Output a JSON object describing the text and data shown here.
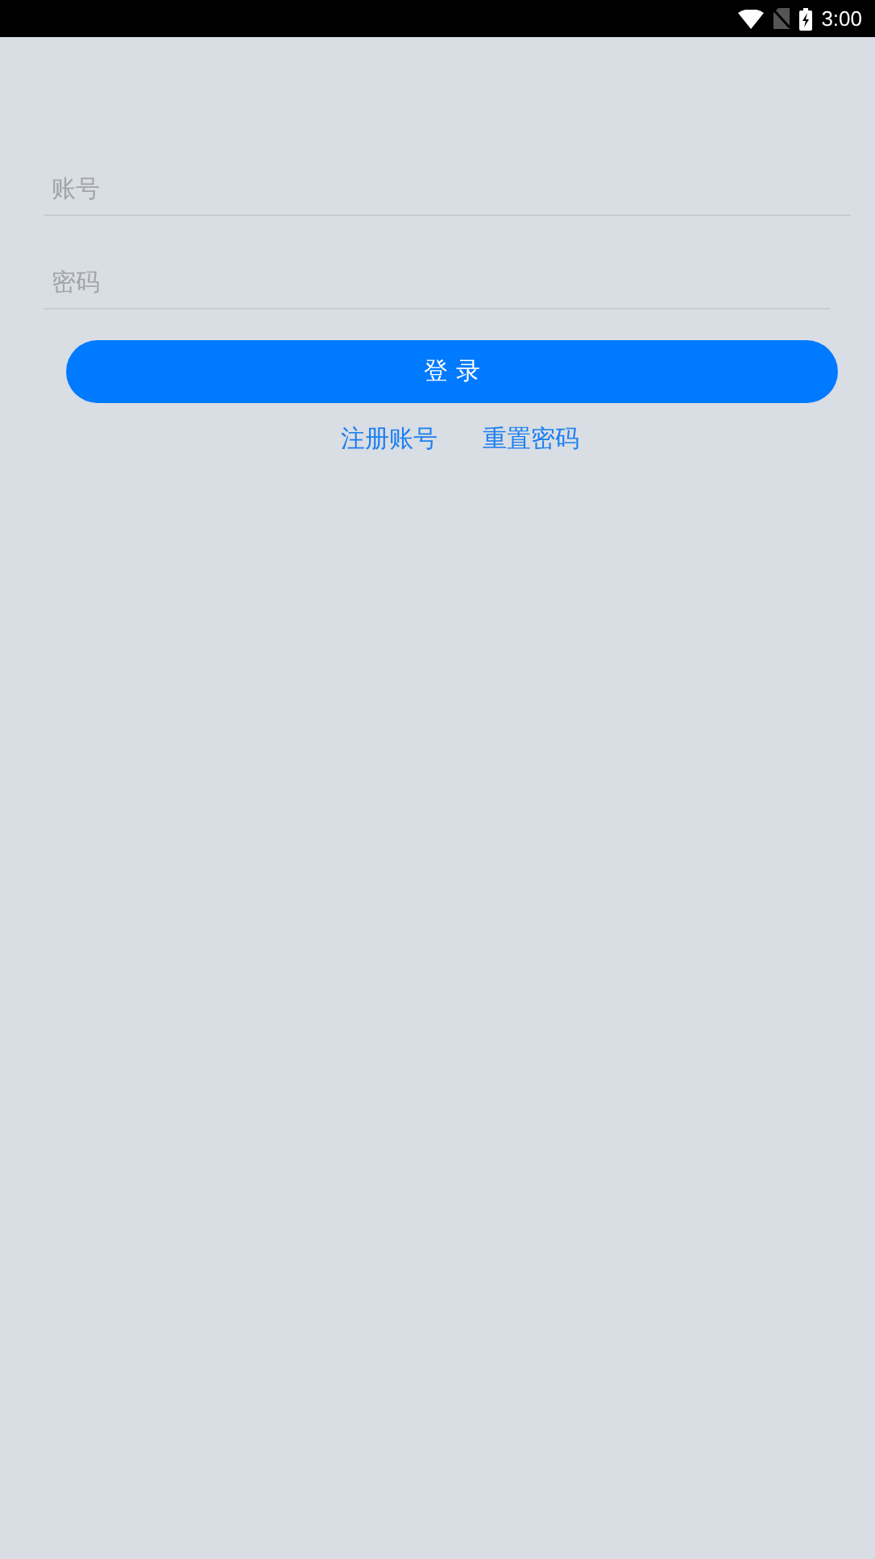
{
  "status_bar": {
    "time": "3:00"
  },
  "fields": [
    {
      "placeholder": "账号"
    },
    {
      "placeholder": "密码"
    }
  ],
  "login_button": "登 录",
  "links": [
    "注册账号",
    "重置密码"
  ]
}
